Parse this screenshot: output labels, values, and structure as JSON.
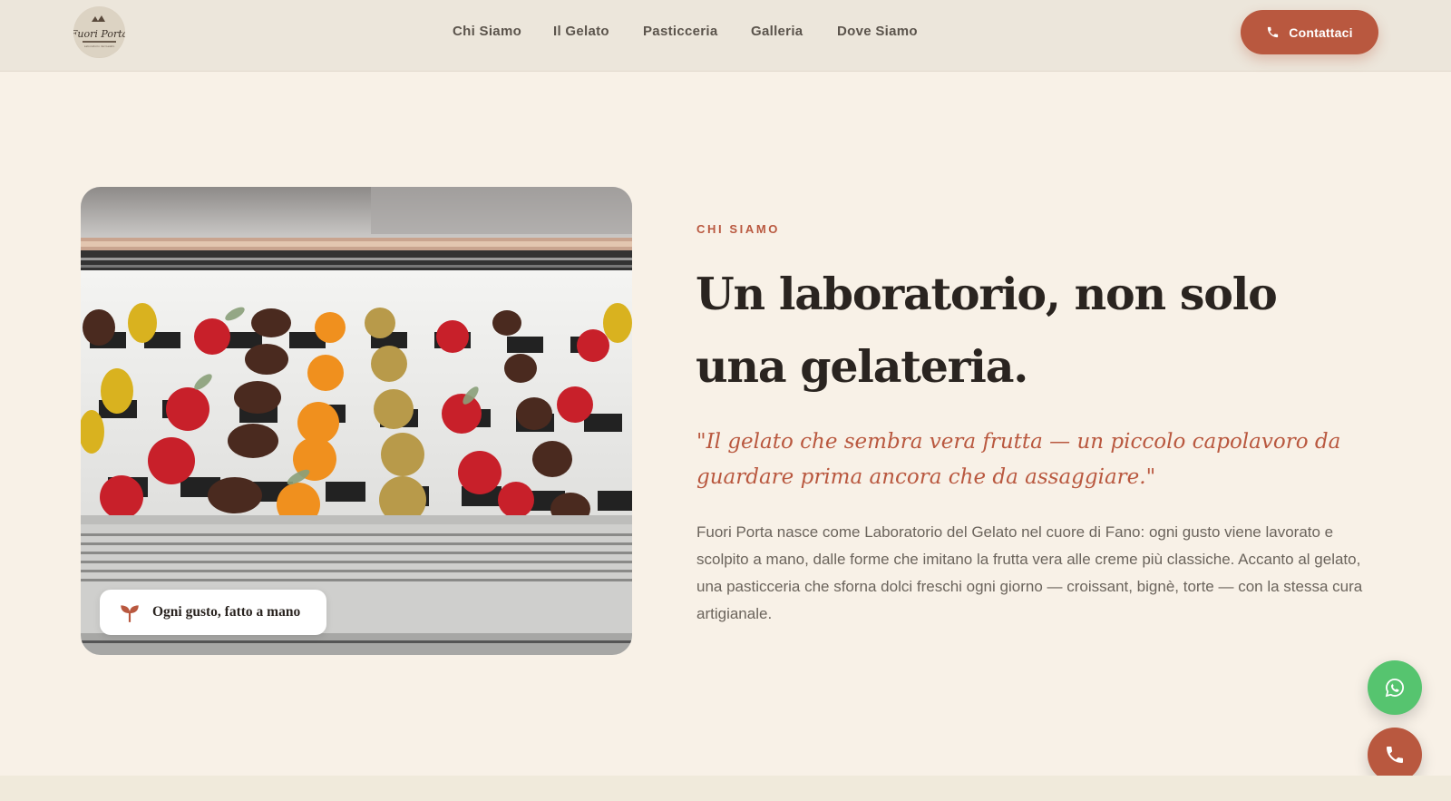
{
  "header": {
    "logo_text": "Fuori Porta",
    "logo_subtext": "Laboratorio del Gelato",
    "nav": [
      {
        "label": "Chi Siamo"
      },
      {
        "label": "Il Gelato"
      },
      {
        "label": "Pasticceria"
      },
      {
        "label": "Galleria"
      },
      {
        "label": "Dove Siamo"
      }
    ],
    "contact_label": "Contattaci"
  },
  "about": {
    "eyebrow": "CHI SIAMO",
    "headline": "Un laboratorio, non solo una gelateria.",
    "quote": "\"Il gelato che sembra vera frutta — un piccolo capolavoro da guardare prima ancora che da assaggiare.\"",
    "body": "Fuori Porta nasce come Laboratorio del Gelato nel cuore di Fano: ogni gusto viene lavorato e scolpito a mano, dalle forme che imitano la frutta vera alle creme più classiche. Accanto al gelato, una pasticceria che sforna dolci freschi ogni giorno — croissant, bignè, torte — con la stessa cura artigianale.",
    "image_badge": "Ogni gusto, fatto a mano"
  },
  "colors": {
    "accent": "#b9583f",
    "background": "#f8f1e7",
    "whatsapp": "#56c46f"
  },
  "icons": {
    "contact": "phone-icon",
    "badge": "sprout-icon",
    "fab_1": "whatsapp-icon",
    "fab_2": "phone-icon"
  }
}
